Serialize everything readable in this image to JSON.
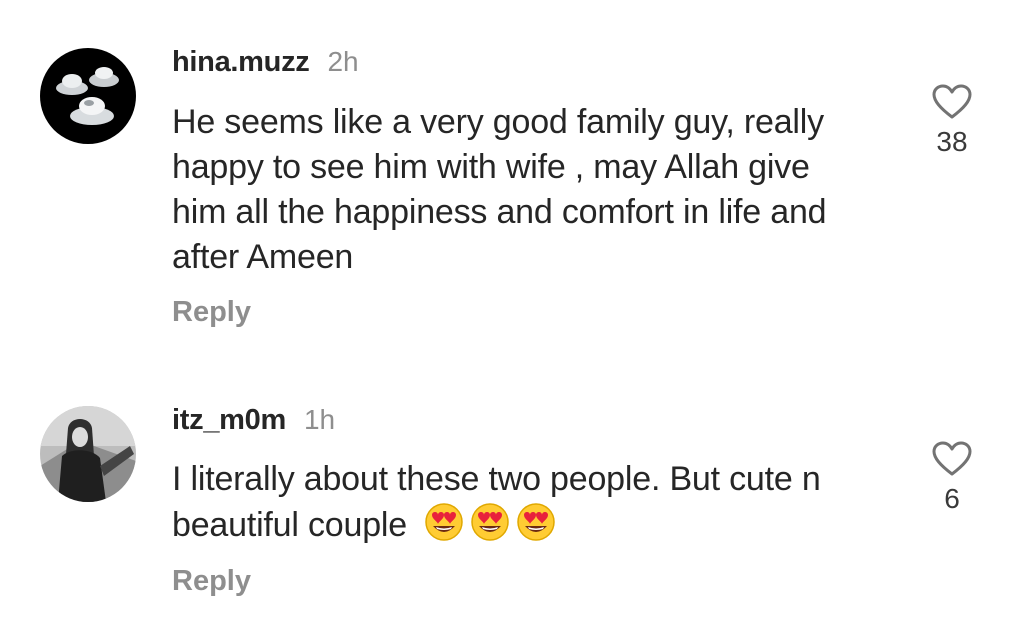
{
  "comments": [
    {
      "username": "hina.muzz",
      "time": "2h",
      "text": "He seems like a very good family guy, really happy to see him with wife , may Allah give him all the happiness and comfort in life and after Ameen",
      "reply_label": "Reply",
      "likes": "38",
      "avatar_icon": "cupcakes-avatar"
    },
    {
      "username": "itz_m0m",
      "time": "1h",
      "text": "I literally about these two people. But cute n beautiful couple",
      "emojis": [
        "heart-eyes-emoji",
        "heart-eyes-emoji",
        "heart-eyes-emoji"
      ],
      "reply_label": "Reply",
      "likes": "6",
      "avatar_icon": "woman-photo-avatar"
    }
  ],
  "colors": {
    "text": "#262626",
    "muted": "#8e8e8e",
    "background": "#ffffff"
  }
}
